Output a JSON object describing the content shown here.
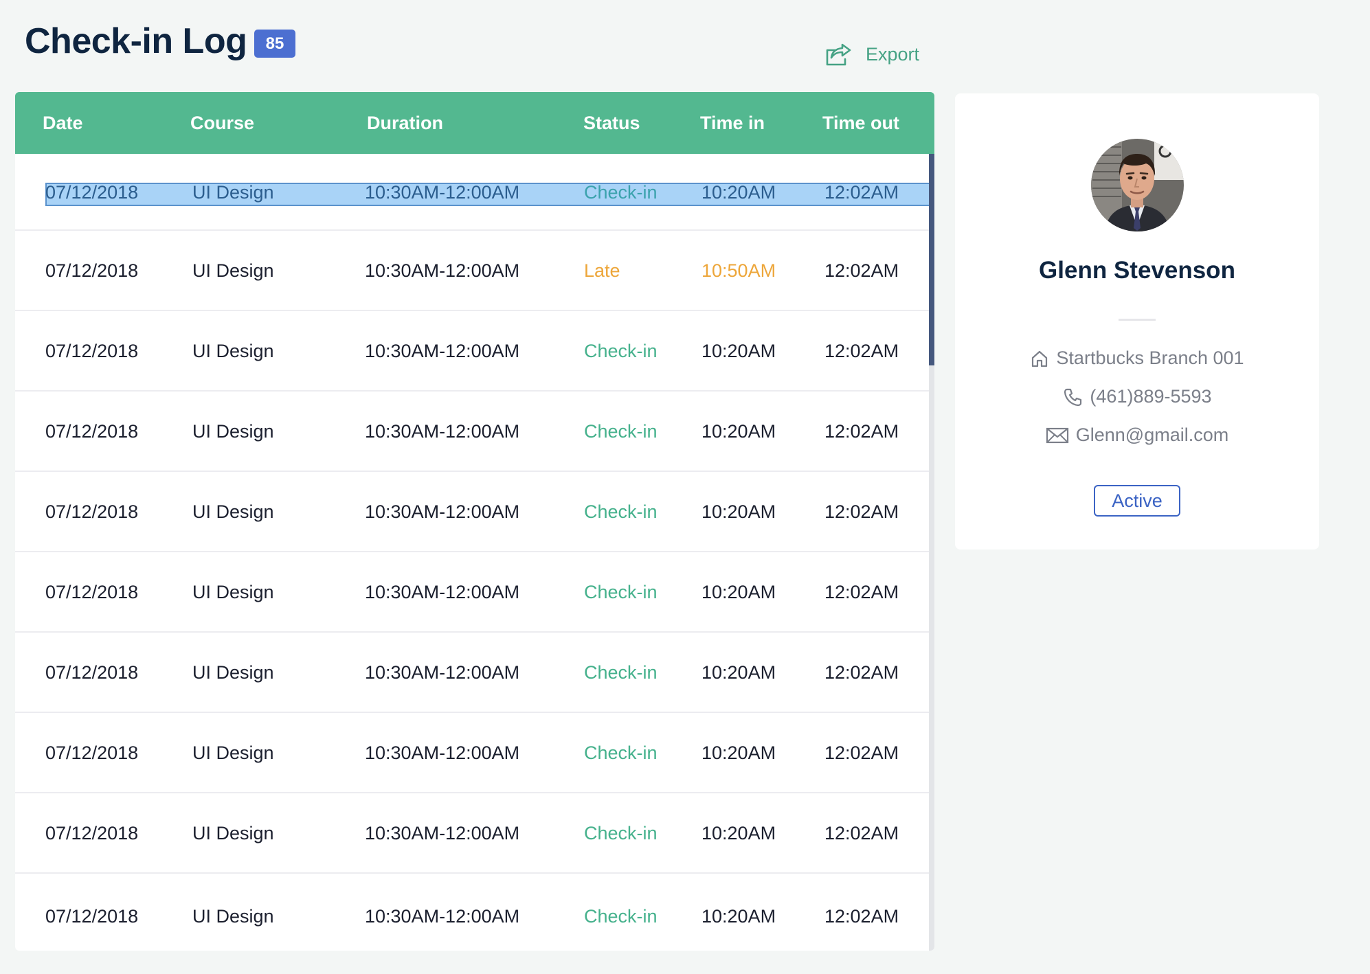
{
  "header": {
    "title": "Check-in Log",
    "count": "85",
    "export_label": "Export"
  },
  "table": {
    "columns": {
      "date": "Date",
      "course": "Course",
      "duration": "Duration",
      "status": "Status",
      "time_in": "Time in",
      "time_out": "Time out"
    },
    "rows": [
      {
        "date": "07/12/2018",
        "course": "UI Design",
        "duration": "10:30AM-12:00AM",
        "status": "Check-in",
        "time_in": "10:20AM",
        "time_out": "12:02AM"
      },
      {
        "date": "07/12/2018",
        "course": "UI Design",
        "duration": "10:30AM-12:00AM",
        "status": "Late",
        "time_in": "10:50AM",
        "time_out": "12:02AM"
      },
      {
        "date": "07/12/2018",
        "course": "UI Design",
        "duration": "10:30AM-12:00AM",
        "status": "Check-in",
        "time_in": "10:20AM",
        "time_out": "12:02AM"
      },
      {
        "date": "07/12/2018",
        "course": "UI Design",
        "duration": "10:30AM-12:00AM",
        "status": "Check-in",
        "time_in": "10:20AM",
        "time_out": "12:02AM"
      },
      {
        "date": "07/12/2018",
        "course": "UI Design",
        "duration": "10:30AM-12:00AM",
        "status": "Check-in",
        "time_in": "10:20AM",
        "time_out": "12:02AM"
      },
      {
        "date": "07/12/2018",
        "course": "UI Design",
        "duration": "10:30AM-12:00AM",
        "status": "Check-in",
        "time_in": "10:20AM",
        "time_out": "12:02AM"
      },
      {
        "date": "07/12/2018",
        "course": "UI Design",
        "duration": "10:30AM-12:00AM",
        "status": "Check-in",
        "time_in": "10:20AM",
        "time_out": "12:02AM"
      },
      {
        "date": "07/12/2018",
        "course": "UI Design",
        "duration": "10:30AM-12:00AM",
        "status": "Check-in",
        "time_in": "10:20AM",
        "time_out": "12:02AM"
      },
      {
        "date": "07/12/2018",
        "course": "UI Design",
        "duration": "10:30AM-12:00AM",
        "status": "Check-in",
        "time_in": "10:20AM",
        "time_out": "12:02AM"
      },
      {
        "date": "07/12/2018",
        "course": "UI Design",
        "duration": "10:30AM-12:00AM",
        "status": "Check-in",
        "time_in": "10:20AM",
        "time_out": "12:02AM"
      }
    ]
  },
  "profile": {
    "name": "Glenn Stevenson",
    "branch": "Startbucks Branch 001",
    "phone": "(461)889-5593",
    "email": "Glenn@gmail.com",
    "status": "Active"
  },
  "colors": {
    "header_green": "#53b890",
    "checkin_green": "#45b18c",
    "late_orange": "#eda63a",
    "badge_blue": "#4c6fd1",
    "active_blue": "#3b63c4",
    "title_navy": "#0f2540"
  },
  "icons": {
    "export": "share-export-icon",
    "branch": "home-icon",
    "phone": "phone-icon",
    "email": "envelope-icon"
  }
}
